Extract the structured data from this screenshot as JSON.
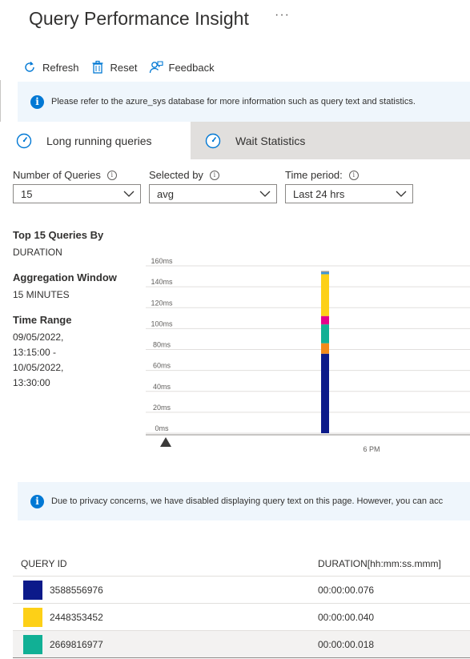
{
  "page": {
    "title": "Query Performance Insight",
    "more": "···"
  },
  "toolbar": {
    "refresh": "Refresh",
    "reset": "Reset",
    "feedback": "Feedback"
  },
  "info_top": "Please refer to the azure_sys database for more information such as query text and statistics.",
  "tabs": [
    {
      "label": "Long running queries",
      "active": true
    },
    {
      "label": "Wait Statistics",
      "active": false
    }
  ],
  "filters": {
    "num_queries": {
      "label": "Number of Queries",
      "value": "15"
    },
    "selected_by": {
      "label": "Selected by",
      "value": "avg"
    },
    "time_period": {
      "label": "Time period:",
      "value": "Last 24 hrs"
    }
  },
  "summary": {
    "top_label": "Top 15 Queries By",
    "top_value": "DURATION",
    "agg_label": "Aggregation Window",
    "agg_value": "15 MINUTES",
    "range_label": "Time Range",
    "range_lines": [
      "09/05/2022,",
      "13:15:00 -",
      "10/05/2022,",
      "13:30:00"
    ]
  },
  "chart_data": {
    "type": "bar",
    "stacked": true,
    "y_ticks": [
      "0ms",
      "20ms",
      "40ms",
      "60ms",
      "80ms",
      "100ms",
      "120ms",
      "140ms",
      "160ms"
    ],
    "ylim": [
      0,
      160
    ],
    "x_ticks": [
      "6 PM"
    ],
    "series": [
      {
        "values": [
          76
        ],
        "color": "#0c1a8a"
      },
      {
        "values": [
          10
        ],
        "color": "#f28a1a"
      },
      {
        "values": [
          18
        ],
        "color": "#11b095"
      },
      {
        "values": [
          8
        ],
        "color": "#e3008c"
      },
      {
        "values": [
          40
        ],
        "color": "#fdd017"
      },
      {
        "values": [
          2
        ],
        "color": "#3a96dd"
      },
      {
        "values": [
          1
        ],
        "color": "#8a8886"
      }
    ]
  },
  "info_bottom": "Due to privacy concerns, we have disabled displaying query text on this page. However, you can acc",
  "table": {
    "headers": [
      "QUERY ID",
      "DURATION[hh:mm:ss.mmm]"
    ],
    "rows": [
      {
        "id": "3588556976",
        "duration": "00:00:00.076",
        "color": "#0c1a8a"
      },
      {
        "id": "2448353452",
        "duration": "00:00:00.040",
        "color": "#fdd017"
      },
      {
        "id": "2669816977",
        "duration": "00:00:00.018",
        "color": "#11b095"
      }
    ]
  }
}
